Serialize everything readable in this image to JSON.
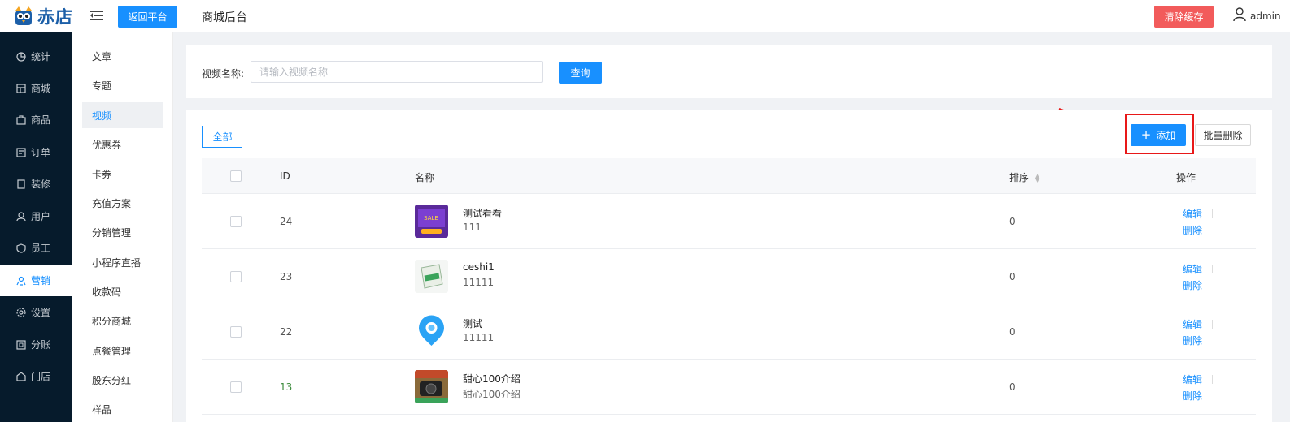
{
  "header": {
    "logo_text": "赤店",
    "back_button": "返回平台",
    "title": "商城后台",
    "clear_cache_button": "清除缓存",
    "user_name": "admin"
  },
  "sidebar": {
    "items": [
      {
        "label": "统计",
        "icon": "chart-icon"
      },
      {
        "label": "商城",
        "icon": "store-icon"
      },
      {
        "label": "商品",
        "icon": "goods-icon"
      },
      {
        "label": "订单",
        "icon": "order-icon"
      },
      {
        "label": "装修",
        "icon": "decorate-icon"
      },
      {
        "label": "用户",
        "icon": "user-icon"
      },
      {
        "label": "员工",
        "icon": "staff-icon"
      },
      {
        "label": "营销",
        "icon": "marketing-icon",
        "active": true
      },
      {
        "label": "设置",
        "icon": "gear-icon"
      },
      {
        "label": "分账",
        "icon": "split-icon"
      },
      {
        "label": "门店",
        "icon": "shop-icon"
      }
    ]
  },
  "subnav": {
    "items": [
      "文章",
      "专题",
      "视频",
      "优惠券",
      "卡券",
      "充值方案",
      "分销管理",
      "小程序直播",
      "收款码",
      "积分商城",
      "点餐管理",
      "股东分红",
      "样品"
    ],
    "active": "视频"
  },
  "search": {
    "label": "视频名称:",
    "placeholder": "请输入视频名称",
    "value": "",
    "button": "查询"
  },
  "toolbar": {
    "tab_all": "全部",
    "add_button": "添加",
    "batch_delete_button": "批量删除"
  },
  "table": {
    "columns": {
      "id": "ID",
      "name": "名称",
      "sort": "排序",
      "actions": "操作"
    },
    "rows": [
      {
        "id": "24",
        "title": "测试看看",
        "subtitle": "111",
        "sort": "0",
        "edit": "编辑",
        "delete": "删除",
        "thumb": "purple-promo"
      },
      {
        "id": "23",
        "title": "ceshi1",
        "subtitle": "11111",
        "sort": "0",
        "edit": "编辑",
        "delete": "删除",
        "thumb": "green-pack"
      },
      {
        "id": "22",
        "title": "测试",
        "subtitle": "11111",
        "sort": "0",
        "edit": "编辑",
        "delete": "删除",
        "thumb": "blue-pin"
      },
      {
        "id": "13",
        "title": "甜心100介绍",
        "subtitle": "甜心100介绍",
        "sort": "0",
        "edit": "编辑",
        "delete": "删除",
        "thumb": "camera-photo"
      }
    ]
  },
  "colors": {
    "primary": "#1890ff",
    "danger": "#f25b5b",
    "sidebar_bg": "#061b2c",
    "highlight": "#e81818"
  }
}
